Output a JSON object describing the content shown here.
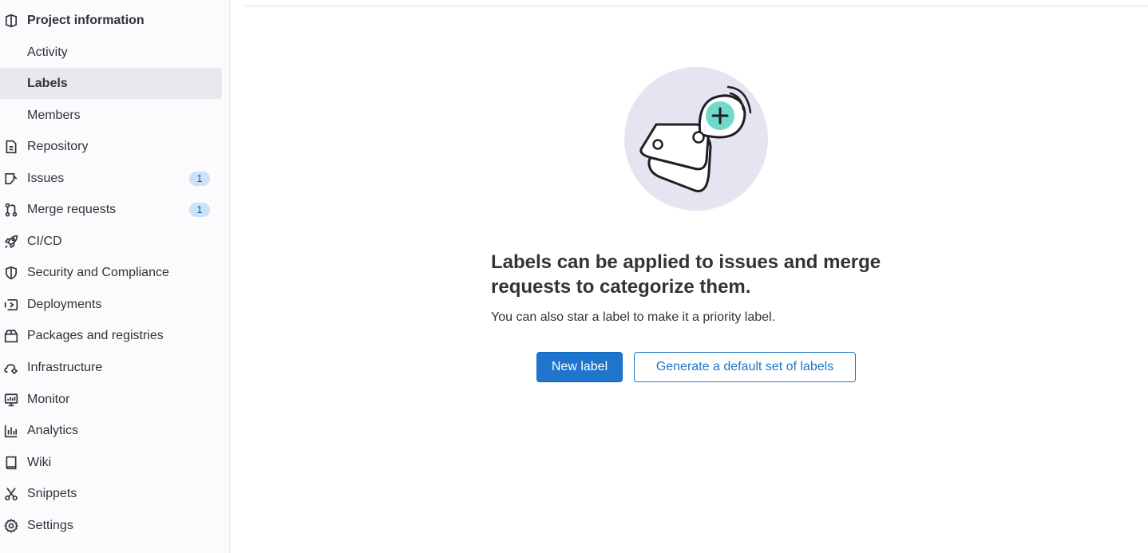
{
  "sidebar": {
    "items": [
      {
        "label": "Project information",
        "icon": "project-icon",
        "type": "header"
      },
      {
        "label": "Activity",
        "type": "sub"
      },
      {
        "label": "Labels",
        "type": "sub",
        "active": true
      },
      {
        "label": "Members",
        "type": "sub"
      },
      {
        "label": "Repository",
        "icon": "document-icon"
      },
      {
        "label": "Issues",
        "icon": "issues-icon",
        "badge": "1"
      },
      {
        "label": "Merge requests",
        "icon": "merge-request-icon",
        "badge": "1"
      },
      {
        "label": "CI/CD",
        "icon": "rocket-icon"
      },
      {
        "label": "Security and Compliance",
        "icon": "shield-icon"
      },
      {
        "label": "Deployments",
        "icon": "deployments-icon"
      },
      {
        "label": "Packages and registries",
        "icon": "package-icon"
      },
      {
        "label": "Infrastructure",
        "icon": "cloud-gear-icon"
      },
      {
        "label": "Monitor",
        "icon": "monitor-icon"
      },
      {
        "label": "Analytics",
        "icon": "chart-icon"
      },
      {
        "label": "Wiki",
        "icon": "book-icon"
      },
      {
        "label": "Snippets",
        "icon": "scissors-icon"
      },
      {
        "label": "Settings",
        "icon": "gear-icon"
      }
    ]
  },
  "empty_state": {
    "illustration": "labels-illustration",
    "title": "Labels can be applied to issues and merge requests to categorize them.",
    "description": "You can also star a label to make it a priority label.",
    "primary_button": "New label",
    "secondary_button": "Generate a default set of labels"
  },
  "colors": {
    "primary": "#1f75cb",
    "sidebar_bg": "#fbfafd",
    "active_item_bg": "#e9e8ed",
    "badge_bg": "#cbe2f9",
    "illustration_circle": "#e6e4f0",
    "illustration_accent": "#6fdac8"
  }
}
